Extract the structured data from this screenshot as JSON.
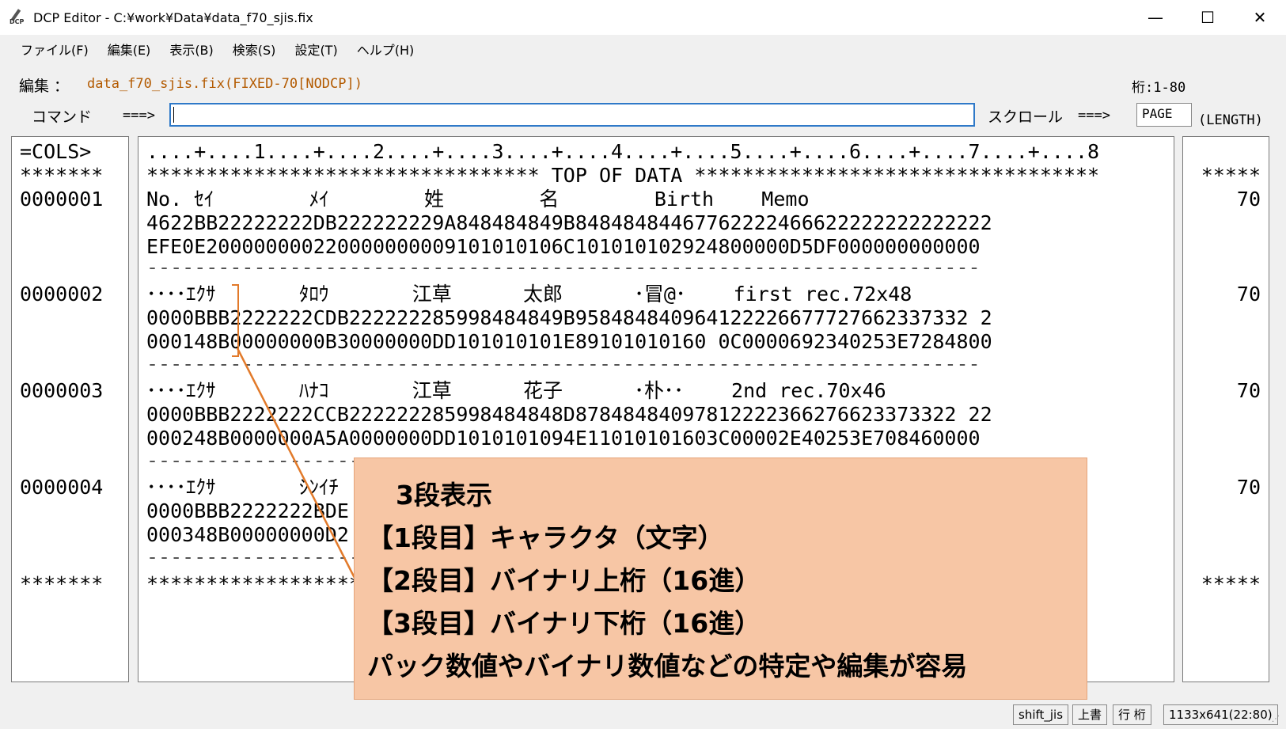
{
  "window": {
    "icon_text": "DCP",
    "title": "DCP Editor - C:¥work¥Data¥data_f70_sjis.fix",
    "minimize": "—",
    "maximize": "☐",
    "close": "✕"
  },
  "menu": [
    "ファイル(F)",
    "編集(E)",
    "表示(B)",
    "検索(S)",
    "設定(T)",
    "ヘルプ(H)"
  ],
  "header": {
    "edit_label": "編集 ：",
    "edit_value": "data_f70_sjis.fix(FIXED-70[NODCP])",
    "col_range": "桁:1-80",
    "command_label": "コマンド",
    "command_arrow": "===>",
    "command_value": "",
    "scroll_label": "スクロール",
    "scroll_arrow": "===>",
    "scroll_value": "PAGE",
    "length_label": "(LENGTH)"
  },
  "left_rows": [
    "=COLS>",
    "*******",
    "0000001",
    "",
    "",
    "",
    "0000002",
    "",
    "",
    "",
    "0000003",
    "",
    "",
    "",
    "0000004",
    "",
    "",
    "",
    "*******"
  ],
  "main_rows": [
    "....+....1....+....2....+....3....+....4....+....5....+....6....+....7....+....8",
    "********************************* TOP OF DATA **********************************",
    "No. ｾｲ        ﾒｲ        姓        名        Birth    Memo",
    "4622BB22222222DB222222229A848484849B84848484467762222466622222222222222",
    "EFE0E200000000220000000009101010106C101010102924800000D5DF000000000000",
    "----------------------------------------------------------------------",
    "････ｴｸｻ       ﾀﾛｳ       江草      太郎      ･冒@･    first rec.72x48",
    "0000BBB2222222CDB222222285998484849B958484840964122226677727662337332 2",
    "000148B00000000B30000000DD101010101E89101010160 0C0000692340253E7284800",
    "----------------------------------------------------------------------",
    "････ｴｸｻ       ﾊﾅｺ       江草      花子      ･朴･･    2nd rec.70x46",
    "0000BBB2222222CCB222222285998484848D87848484097812222366276623373322 22",
    "000248B0000000A5A0000000DD1010101094E11010101603C00002E40253E708460000",
    "----------------------------------------------------------------------",
    "････ｴｸｻ       ｼﾝｲﾁ",
    "0000BBB2222222BDE",
    "000348B00000000D2",
    "-------------------------",
    "****************************  ************************************* ********"
  ],
  "right_rows": [
    "",
    "*****",
    "70",
    "",
    "",
    "",
    "70",
    "",
    "",
    "",
    "70",
    "",
    "",
    "",
    "70",
    "",
    "",
    "",
    "*****"
  ],
  "callout": {
    "line1": "3段表示",
    "line2": "【1段目】キャラクタ（文字）",
    "line3": "【2段目】バイナリ上桁（16進）",
    "line4": "【3段目】バイナリ下桁（16進）",
    "line5": "パック数値やバイナリ数値などの特定や編集が容易"
  },
  "status": {
    "encoding": "shift_jis",
    "mode": "上書",
    "unit": "行 桁",
    "size": "1133x641(22:80)"
  },
  "colors": {
    "accent_orange": "#e27a2a",
    "callout_bg": "#f7c6a5",
    "edit_value": "#b35a00",
    "input_border": "#2f79c8"
  }
}
